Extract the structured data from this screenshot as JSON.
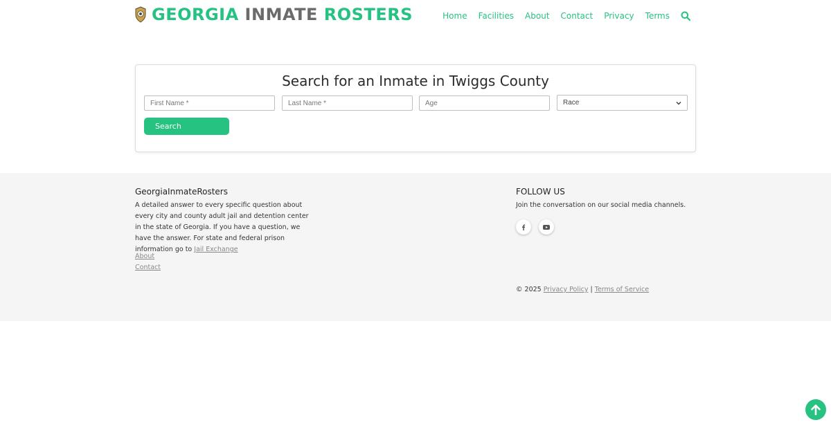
{
  "header": {
    "brand_part1": "GEORGIA",
    "brand_part2": "INMATE",
    "brand_part3": "ROSTERS",
    "nav": [
      "Home",
      "Facilities",
      "About",
      "Contact",
      "Privacy",
      "Terms"
    ],
    "search_icon": "search-icon"
  },
  "search": {
    "title": "Search for an Inmate in Twiggs County",
    "first_name_placeholder": "First Name *",
    "last_name_placeholder": "Last Name *",
    "age_placeholder": "Age",
    "race_selected": "Race",
    "button_label": "Search"
  },
  "footer": {
    "title": "GeorgiaInmateRosters",
    "description": "A detailed answer to every specific question about every city and county adult jail and detention center in the state of Georgia. If you have a question, we have the answer. For state and federal prison information go to",
    "jail_exchange_link": "Jail Exchange",
    "about_link": "About",
    "contact_link": "Contact",
    "follow_title": "FOLLOW US",
    "follow_desc": "Join the conversation on our social media channels.",
    "social_icons": [
      "facebook-icon",
      "youtube-icon"
    ],
    "copyright": "© 2025",
    "privacy_link": "Privacy Policy",
    "separator": "|",
    "terms_link": "Terms of Service"
  },
  "colors": {
    "accent": "#26c281",
    "brand_gray": "#6b6b6b",
    "footer_bg": "#f5f5f5"
  }
}
